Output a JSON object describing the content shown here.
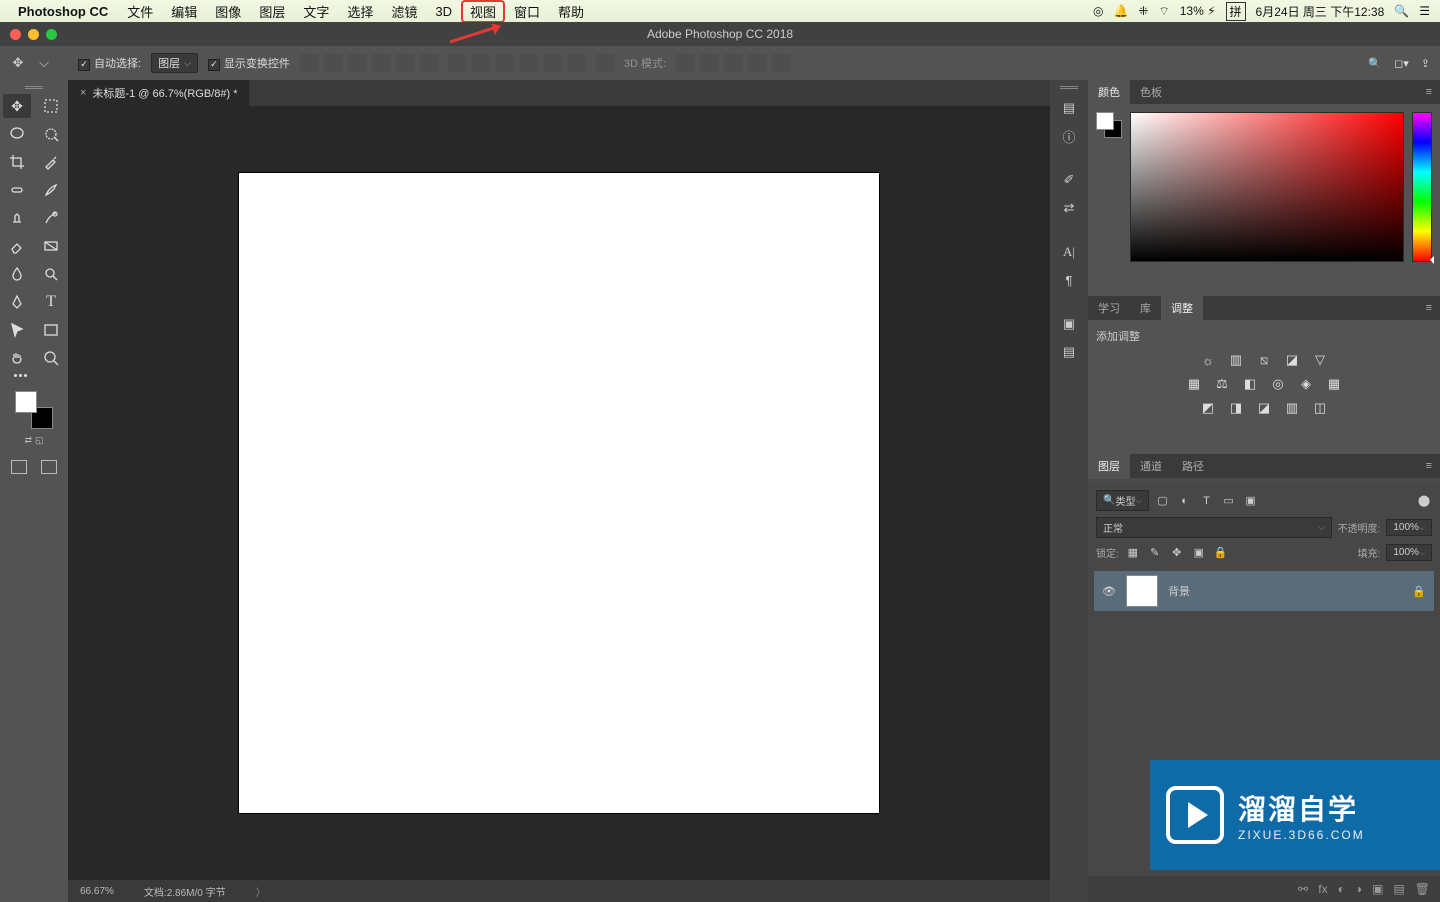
{
  "menubar": {
    "app": "Photoshop CC",
    "items": [
      "文件",
      "编辑",
      "图像",
      "图层",
      "文字",
      "选择",
      "滤镜",
      "3D",
      "视图",
      "窗口",
      "帮助"
    ],
    "highlight_index": 8,
    "right": {
      "battery": "13%",
      "ime": "拼",
      "date": "6月24日 周三 下午12:38"
    }
  },
  "window": {
    "title": "Adobe Photoshop CC 2018"
  },
  "options": {
    "auto_select": "自动选择:",
    "layer_sel": "图层",
    "show_transform": "显示变换控件",
    "mode3d": "3D 模式:"
  },
  "tab": {
    "label": "未标题-1 @ 66.7%(RGB/8#) *"
  },
  "status": {
    "zoom": "66.67%",
    "doc": "文档:2.86M/0 字节"
  },
  "panels": {
    "color_tabs": [
      "颜色",
      "色板"
    ],
    "adjust_tabs": [
      "学习",
      "库",
      "调整"
    ],
    "adjust_title": "添加调整",
    "layer_tabs": [
      "图层",
      "通道",
      "路径"
    ],
    "filter": "类型",
    "blend": "正常",
    "opacity_lbl": "不透明度:",
    "opacity": "100%",
    "lock_lbl": "锁定:",
    "fill_lbl": "填充:",
    "fill": "100%",
    "layer_name": "背景"
  },
  "brand": {
    "big": "溜溜自学",
    "small": "ZIXUE.3D66.COM"
  }
}
